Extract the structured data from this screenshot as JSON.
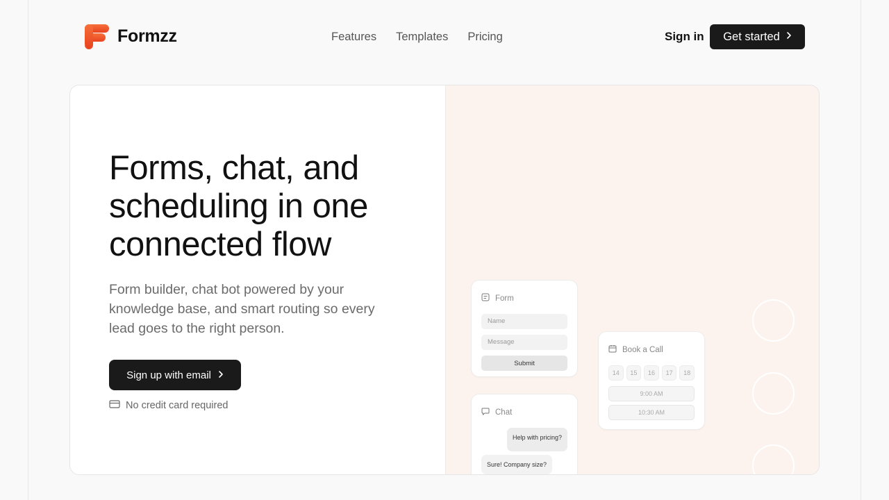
{
  "brand": {
    "name": "Formzz",
    "accent": "#f4572b"
  },
  "nav": {
    "items": [
      "Features",
      "Templates",
      "Pricing"
    ]
  },
  "header": {
    "signin": "Sign in",
    "cta": "Get started"
  },
  "hero": {
    "headline": "Forms, chat, and scheduling in one connected flow",
    "subtext": "Form builder, chat bot powered by your knowledge base, and smart routing so every lead goes to the right person.",
    "cta": "Sign up with email",
    "note": "No credit card required"
  },
  "form_card": {
    "title": "Form",
    "name_placeholder": "Name",
    "message_placeholder": "Message",
    "submit": "Submit"
  },
  "chat_card": {
    "title": "Chat",
    "user_msg": "Help with pricing?",
    "bot_msg": "Sure! Company size?"
  },
  "book_card": {
    "title": "Book a Call",
    "days": [
      "14",
      "15",
      "16",
      "17",
      "18"
    ],
    "slots": [
      "9:00 AM",
      "10:30 AM"
    ]
  },
  "icons": {
    "form": "form-doc-icon",
    "chat": "chat-bubble-icon",
    "calendar": "calendar-icon",
    "card": "credit-card-icon",
    "chevron": "chevron-right-icon"
  }
}
